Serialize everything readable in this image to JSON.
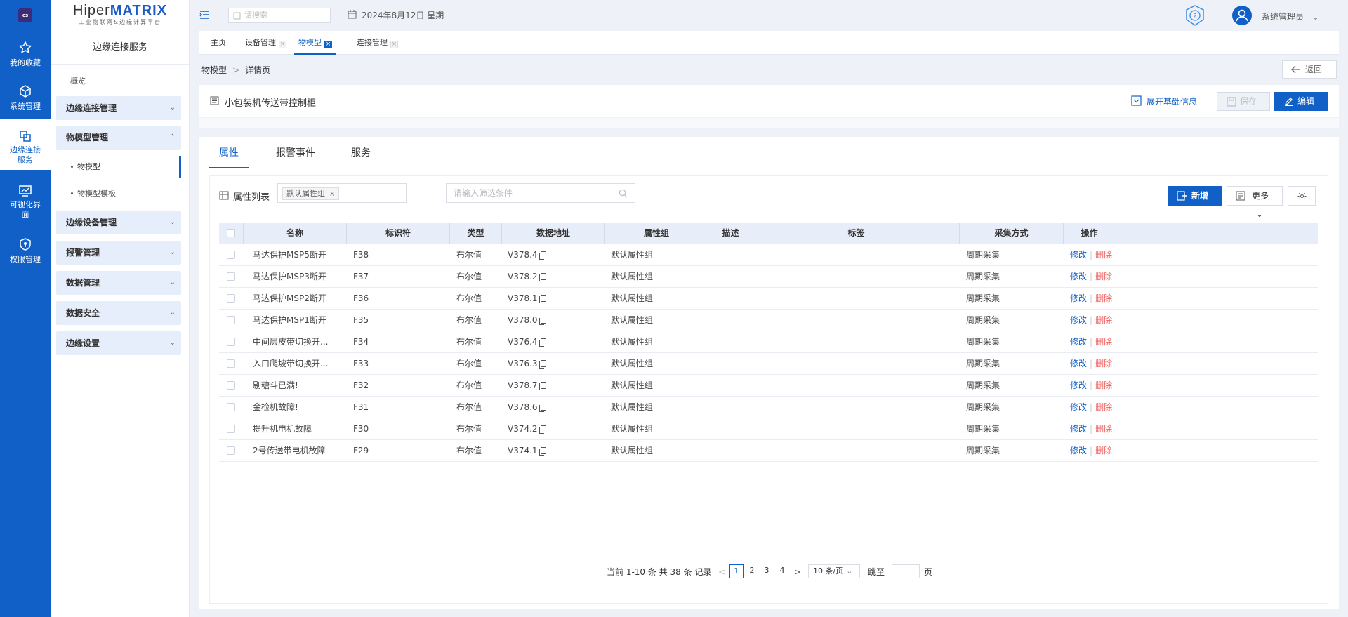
{
  "rail": {
    "logo": "cs",
    "items": [
      {
        "label": "我的收藏",
        "icon": "star-icon"
      },
      {
        "label": "系统管理",
        "icon": "cube-icon"
      },
      {
        "label": "边缘连接\n服务",
        "icon": "connect-icon"
      },
      {
        "label": "可视化界\n面",
        "icon": "monitor-icon"
      },
      {
        "label": "权限管理",
        "icon": "shield-icon"
      }
    ]
  },
  "brand": {
    "name_a": "Hiper",
    "name_b": "MATRIX",
    "subtitle": "工业物联网&边缘计算平台"
  },
  "sidebar": {
    "title": "边缘连接服务",
    "overview": "概览",
    "groups": [
      {
        "label": "边缘连接管理",
        "expanded": false
      },
      {
        "label": "物模型管理",
        "expanded": true
      },
      {
        "label": "边缘设备管理",
        "expanded": false
      },
      {
        "label": "报警管理",
        "expanded": false
      },
      {
        "label": "数据管理",
        "expanded": false
      },
      {
        "label": "数据安全",
        "expanded": false
      },
      {
        "label": "边缘设置",
        "expanded": false
      }
    ],
    "subitems": [
      {
        "label": "物模型",
        "active": true
      },
      {
        "label": "物模型模板",
        "active": false
      }
    ]
  },
  "header": {
    "search_placeholder": "请搜索",
    "date": "2024年8月12日 星期一",
    "user": "系统管理员"
  },
  "tabs": [
    {
      "label": "主页",
      "closable": false
    },
    {
      "label": "设备管理",
      "closable": true
    },
    {
      "label": "物模型",
      "closable": true,
      "active": true
    },
    {
      "label": "连接管理",
      "closable": true
    }
  ],
  "breadcrumb": {
    "root": "物模型",
    "current": "详情页"
  },
  "back_label": "返回",
  "model_title": "小包装机传送带控制柜",
  "actions": {
    "expand": "展开基础信息",
    "save": "保存",
    "edit": "编辑"
  },
  "sub_tabs": [
    {
      "label": "属性",
      "active": true
    },
    {
      "label": "报警事件",
      "active": false
    },
    {
      "label": "服务",
      "active": false
    }
  ],
  "toolbar": {
    "list_title": "属性列表",
    "group_chip": "默认属性组",
    "filter_placeholder": "请输入筛选条件",
    "add": "新增",
    "more": "更多"
  },
  "table": {
    "columns": [
      "名称",
      "标识符",
      "类型",
      "数据地址",
      "属性组",
      "描述",
      "标签",
      "采集方式",
      "操作"
    ],
    "rows": [
      {
        "name": "马达保护MSP5断开",
        "id": "F38",
        "type": "布尔值",
        "addr": "V378.4",
        "group": "默认属性组",
        "desc": "",
        "tag": "",
        "mode": "周期采集"
      },
      {
        "name": "马达保护MSP3断开",
        "id": "F37",
        "type": "布尔值",
        "addr": "V378.2",
        "group": "默认属性组",
        "desc": "",
        "tag": "",
        "mode": "周期采集"
      },
      {
        "name": "马达保护MSP2断开",
        "id": "F36",
        "type": "布尔值",
        "addr": "V378.1",
        "group": "默认属性组",
        "desc": "",
        "tag": "",
        "mode": "周期采集"
      },
      {
        "name": "马达保护MSP1断开",
        "id": "F35",
        "type": "布尔值",
        "addr": "V378.0",
        "group": "默认属性组",
        "desc": "",
        "tag": "",
        "mode": "周期采集"
      },
      {
        "name": "中间层皮带切换开...",
        "id": "F34",
        "type": "布尔值",
        "addr": "V376.4",
        "group": "默认属性组",
        "desc": "",
        "tag": "",
        "mode": "周期采集"
      },
      {
        "name": "入口爬坡带切换开...",
        "id": "F33",
        "type": "布尔值",
        "addr": "V376.3",
        "group": "默认属性组",
        "desc": "",
        "tag": "",
        "mode": "周期采集"
      },
      {
        "name": "剔糖斗已满!",
        "id": "F32",
        "type": "布尔值",
        "addr": "V378.7",
        "group": "默认属性组",
        "desc": "",
        "tag": "",
        "mode": "周期采集"
      },
      {
        "name": "金检机故障!",
        "id": "F31",
        "type": "布尔值",
        "addr": "V378.6",
        "group": "默认属性组",
        "desc": "",
        "tag": "",
        "mode": "周期采集"
      },
      {
        "name": "提升机电机故障",
        "id": "F30",
        "type": "布尔值",
        "addr": "V374.2",
        "group": "默认属性组",
        "desc": "",
        "tag": "",
        "mode": "周期采集"
      },
      {
        "name": "2号传送带电机故障",
        "id": "F29",
        "type": "布尔值",
        "addr": "V374.1",
        "group": "默认属性组",
        "desc": "",
        "tag": "",
        "mode": "周期采集"
      }
    ],
    "op_edit": "修改",
    "op_delete": "删除"
  },
  "pager": {
    "summary": "当前 1-10 条 共 38 条 记录",
    "pages": [
      "1",
      "2",
      "3",
      "4"
    ],
    "current": "1",
    "page_size": "10 条/页",
    "jump_label": "跳至",
    "page_unit": "页"
  },
  "colors": {
    "primary": "#1160c8",
    "danger": "#f05a5a",
    "header_bg": "#e8eef9"
  }
}
